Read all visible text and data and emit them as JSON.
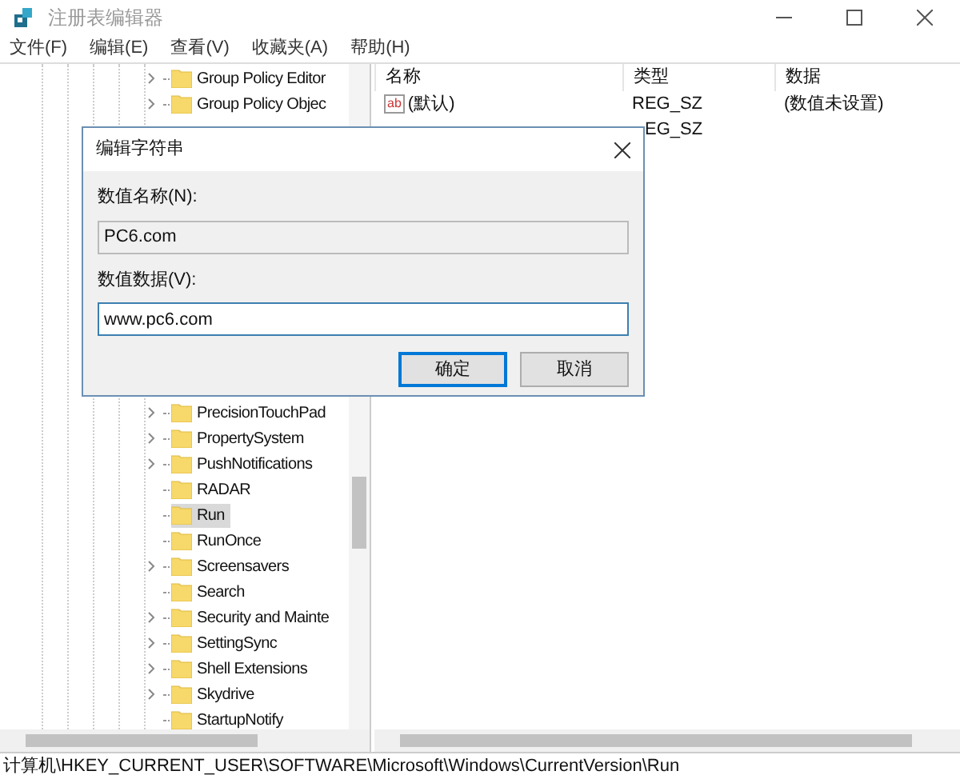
{
  "window": {
    "title": "注册表编辑器"
  },
  "menu": [
    "文件(F)",
    "编辑(E)",
    "查看(V)",
    "收藏夹(A)",
    "帮助(H)"
  ],
  "tree": {
    "items": [
      {
        "label": "Group Policy Editor",
        "expandable": true,
        "selected": false
      },
      {
        "label": "Group Policy Objec",
        "expandable": true,
        "selected": false
      },
      {
        "label": "PrecisionTouchPad",
        "expandable": true,
        "selected": false,
        "gap_before": true
      },
      {
        "label": "PropertySystem",
        "expandable": true,
        "selected": false
      },
      {
        "label": "PushNotifications",
        "expandable": true,
        "selected": false
      },
      {
        "label": "RADAR",
        "expandable": false,
        "selected": false
      },
      {
        "label": "Run",
        "expandable": false,
        "selected": true
      },
      {
        "label": "RunOnce",
        "expandable": false,
        "selected": false
      },
      {
        "label": "Screensavers",
        "expandable": true,
        "selected": false
      },
      {
        "label": "Search",
        "expandable": false,
        "selected": false
      },
      {
        "label": "Security and Mainte",
        "expandable": true,
        "selected": false
      },
      {
        "label": "SettingSync",
        "expandable": true,
        "selected": false
      },
      {
        "label": "Shell Extensions",
        "expandable": true,
        "selected": false
      },
      {
        "label": "Skydrive",
        "expandable": true,
        "selected": false
      },
      {
        "label": "StartupNotify",
        "expandable": false,
        "selected": false
      }
    ]
  },
  "values": {
    "columns": [
      "名称",
      "类型",
      "数据"
    ],
    "rows": [
      {
        "icon": "ab",
        "name": "(默认)",
        "type": "REG_SZ",
        "data": "(数值未设置)"
      },
      {
        "type": "EG_SZ"
      }
    ]
  },
  "dialog": {
    "title": "编辑字符串",
    "name_label": "数值名称(N):",
    "name_value": "PC6.com",
    "data_label": "数值数据(V):",
    "data_value": "www.pc6.com",
    "buttons": [
      {
        "label": "确定",
        "default": true
      },
      {
        "label": "取消",
        "default": false
      }
    ]
  },
  "status_bar": "计算机\\HKEY_CURRENT_USER\\SOFTWARE\\Microsoft\\Windows\\CurrentVersion\\Run"
}
